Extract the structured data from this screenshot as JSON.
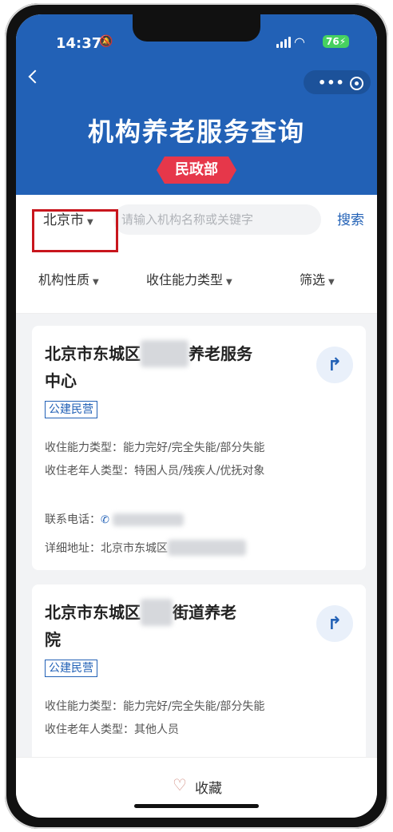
{
  "status_bar": {
    "time": "14:37",
    "battery": "76"
  },
  "header": {
    "title": "机构养老服务查询",
    "badge": "民政部"
  },
  "search": {
    "city": "北京市",
    "placeholder": "请输入机构名称或关键字",
    "button": "搜索"
  },
  "filters": [
    "机构性质",
    "收住能力类型",
    "筛选"
  ],
  "cards": [
    {
      "title_prefix": "北京市东城区",
      "title_suffix": "养老服务",
      "title_line2": "中心",
      "tag": "公建民营",
      "capacity": "收住能力类型：能力完好/完全失能/部分失能",
      "elder_type": "收住老年人类型：特困人员/残疾人/优抚对象",
      "phone_label": "联系电话：",
      "address_label": "详细地址：北京市东城区"
    },
    {
      "title_prefix": "北京市东城区",
      "title_suffix": "街道养老",
      "title_line2": "院",
      "tag": "公建民营",
      "capacity": "收住能力类型：能力完好/完全失能/部分失能",
      "elder_type": "收住老年人类型：其他人员"
    }
  ],
  "bottom": {
    "favorite": "收藏"
  },
  "colors": {
    "brand": "#2261b6",
    "badge": "#e6374a",
    "highlight": "#c8161d"
  },
  "icons": [
    "back-icon",
    "more-icon",
    "record-icon",
    "caret-icon",
    "navigate-icon",
    "phone-icon",
    "heart-icon"
  ]
}
